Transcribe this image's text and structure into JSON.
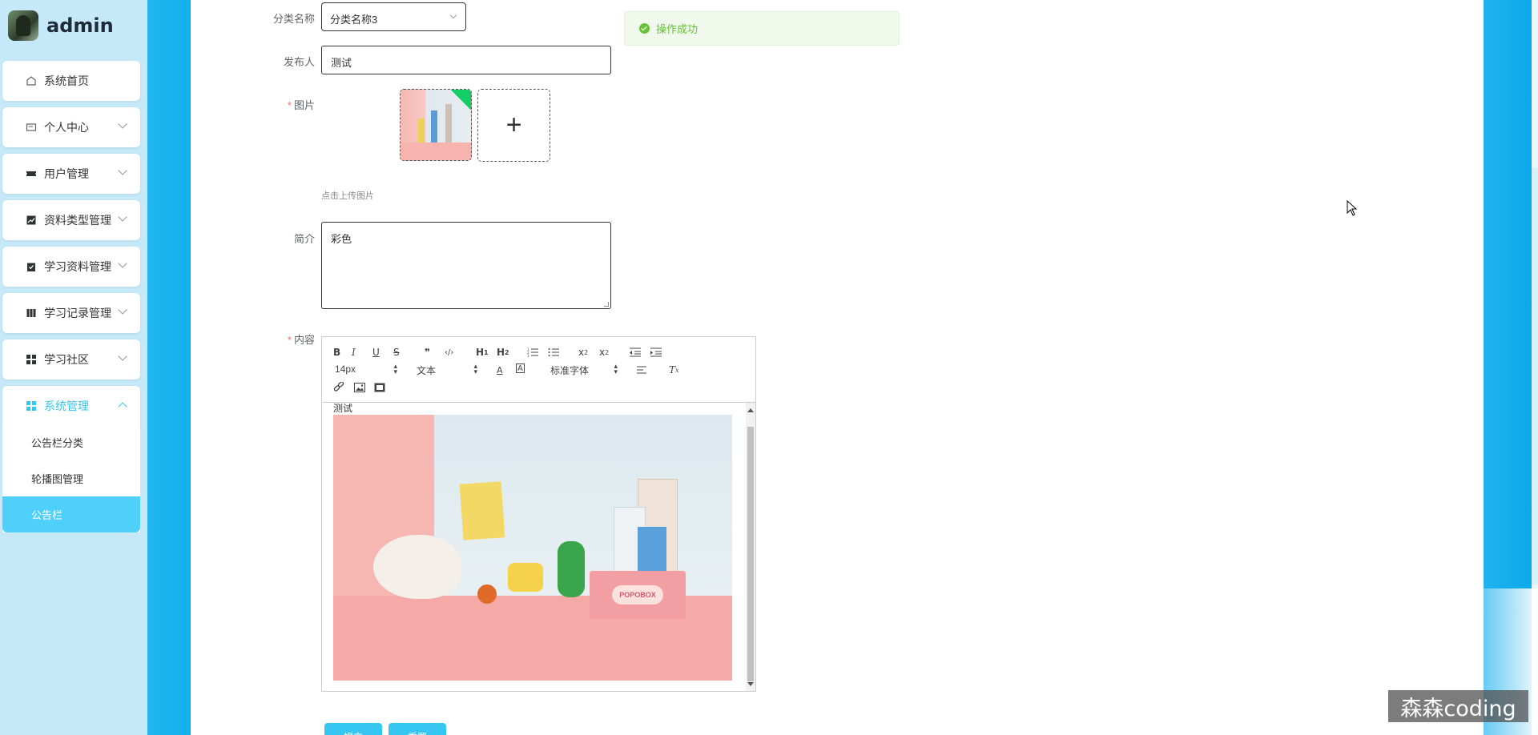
{
  "app": {
    "user": "admin"
  },
  "sidebar": {
    "items": [
      {
        "label": "系统首页",
        "icon": "home-icon"
      },
      {
        "label": "个人中心",
        "icon": "id-card-icon"
      },
      {
        "label": "用户管理",
        "icon": "ticket-icon"
      },
      {
        "label": "资料类型管理",
        "icon": "chart-icon"
      },
      {
        "label": "学习资料管理",
        "icon": "clipboard-icon"
      },
      {
        "label": "学习记录管理",
        "icon": "book-icon"
      },
      {
        "label": "学习社区",
        "icon": "grid-icon"
      },
      {
        "label": "系统管理",
        "icon": "grid-icon"
      }
    ],
    "submenu": [
      {
        "label": "公告栏分类"
      },
      {
        "label": "轮播图管理"
      },
      {
        "label": "公告栏"
      }
    ]
  },
  "form": {
    "category_label": "分类名称",
    "category_value": "分类名称3",
    "publisher_label": "发布人",
    "publisher_value": "测试",
    "image_label": "图片",
    "upload_hint": "点击上传图片",
    "intro_label": "简介",
    "intro_value": "彩色",
    "content_label": "内容",
    "submit_label": "提交",
    "reset_label": "重置"
  },
  "toast": {
    "message": "操作成功",
    "color": "#67c23a"
  },
  "editor": {
    "font_size": "14px",
    "header_select": "文本",
    "font_family": "标准字体",
    "caption": "测试",
    "image_label": "POPOBOX"
  },
  "watermark": "森森coding",
  "colors": {
    "accent": "#36c6f2",
    "sidebar_bg": "#c6e9fa",
    "side_bar": "#0fb0ee"
  }
}
